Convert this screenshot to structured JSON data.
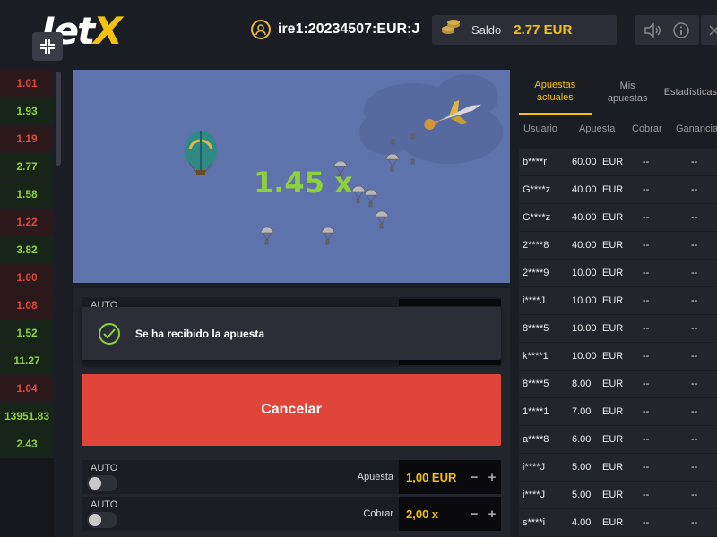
{
  "header": {
    "logo_main": "Jet",
    "logo_x": "X",
    "user_id": "ire1:20234507:EUR:J",
    "balance_label": "Saldo",
    "balance_value": "2.77 EUR"
  },
  "history": [
    "1.01",
    "1.93",
    "1.19",
    "2.77",
    "1.58",
    "1.22",
    "3.82",
    "1.00",
    "1.08",
    "1.52",
    "11.27",
    "1.04",
    "13951.83",
    "2.43"
  ],
  "history_colors": [
    "red",
    "green",
    "red",
    "green",
    "green",
    "red",
    "green",
    "red",
    "red",
    "green",
    "green",
    "red",
    "green",
    "green"
  ],
  "game": {
    "multiplier": "1.45 x"
  },
  "panel": {
    "auto_label": "AUTO",
    "toast_message": "Se ha recibido la apuesta",
    "cancel_label": "Cancelar",
    "bet_label": "Apuesta",
    "bet_value": "1,00 EUR",
    "cashout_label": "Cobrar",
    "cashout_value": "2,00 x",
    "minus": "−",
    "plus": "+"
  },
  "sidebar": {
    "tabs": [
      "Apuestas actuales",
      "Mis apuestas",
      "Estadísticas"
    ],
    "columns": [
      "Usuario",
      "Apuesta",
      "Cobrar",
      "Ganancia"
    ],
    "rows": [
      {
        "user": "b****r",
        "bet": "60.00",
        "cur": "EUR",
        "cash": "--",
        "win": "--"
      },
      {
        "user": "G****z",
        "bet": "40.00",
        "cur": "EUR",
        "cash": "--",
        "win": "--"
      },
      {
        "user": "G****z",
        "bet": "40.00",
        "cur": "EUR",
        "cash": "--",
        "win": "--"
      },
      {
        "user": "2****8",
        "bet": "40.00",
        "cur": "EUR",
        "cash": "--",
        "win": "--"
      },
      {
        "user": "2****9",
        "bet": "10.00",
        "cur": "EUR",
        "cash": "--",
        "win": "--"
      },
      {
        "user": "i****J",
        "bet": "10.00",
        "cur": "EUR",
        "cash": "--",
        "win": "--"
      },
      {
        "user": "8****5",
        "bet": "10.00",
        "cur": "EUR",
        "cash": "--",
        "win": "--"
      },
      {
        "user": "k****1",
        "bet": "10.00",
        "cur": "EUR",
        "cash": "--",
        "win": "--"
      },
      {
        "user": "8****5",
        "bet": "8.00",
        "cur": "EUR",
        "cash": "--",
        "win": "--"
      },
      {
        "user": "1****1",
        "bet": "7.00",
        "cur": "EUR",
        "cash": "--",
        "win": "--"
      },
      {
        "user": "a****8",
        "bet": "6.00",
        "cur": "EUR",
        "cash": "--",
        "win": "--"
      },
      {
        "user": "i****J",
        "bet": "5.00",
        "cur": "EUR",
        "cash": "--",
        "win": "--"
      },
      {
        "user": "i****J",
        "bet": "5.00",
        "cur": "EUR",
        "cash": "--",
        "win": "--"
      },
      {
        "user": "s****i",
        "bet": "4.00",
        "cur": "EUR",
        "cash": "--",
        "win": "--"
      }
    ]
  },
  "colors": {
    "accent": "#f4c20d",
    "win": "#8ed13b",
    "loss": "#e0463b",
    "cancel": "#e0453a",
    "sky": "#5e72ab"
  }
}
